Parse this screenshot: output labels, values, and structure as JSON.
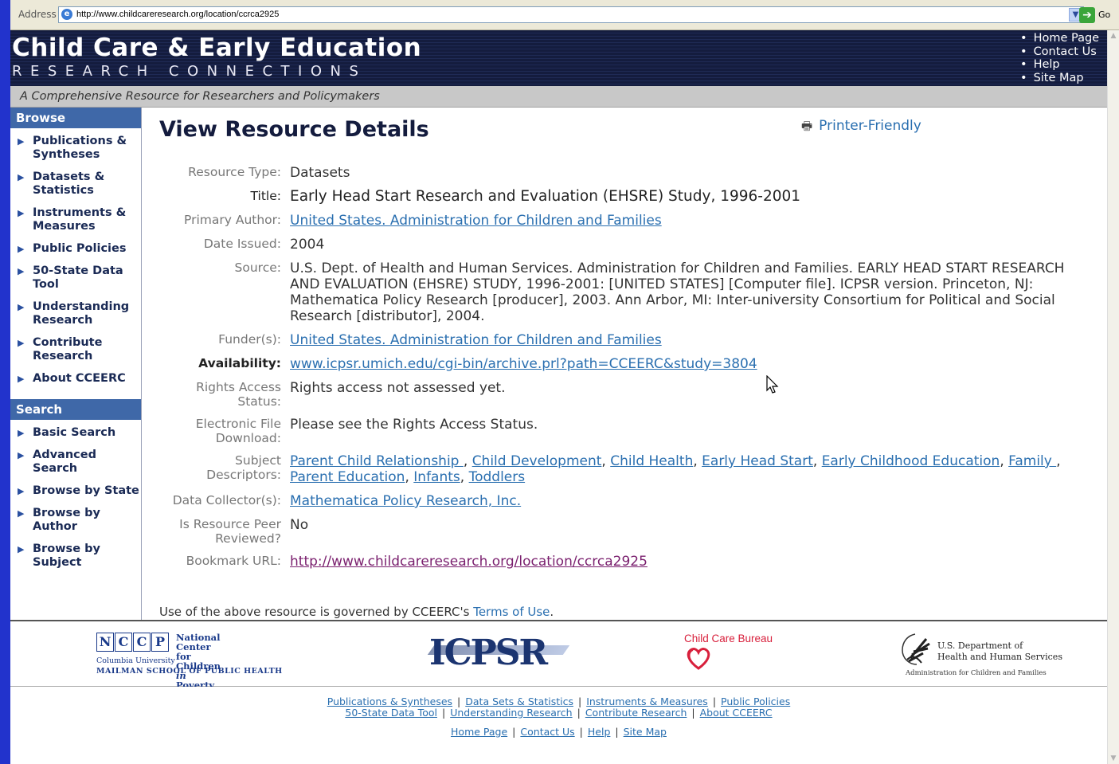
{
  "browser": {
    "address_label": "Address",
    "url": "http://www.childcareresearch.org/location/ccrca2925",
    "go_label": "Go"
  },
  "header": {
    "title": "Child Care & Early Education",
    "subtitle": "RESEARCH CONNECTIONS",
    "top_links": [
      "Home Page",
      "Contact Us",
      "Help",
      "Site Map"
    ],
    "tagline": "A Comprehensive Resource for Researchers and Policymakers"
  },
  "sidebar": {
    "browse_heading": "Browse",
    "browse_items": [
      "Publications & Syntheses",
      "Datasets & Statistics",
      "Instruments & Measures",
      "Public Policies",
      "50-State Data Tool",
      "Understanding Research",
      "Contribute Research",
      "About CCEERC"
    ],
    "search_heading": "Search",
    "search_items": [
      "Basic Search",
      "Advanced Search",
      "Browse by State",
      "Browse by Author",
      "Browse by Subject"
    ]
  },
  "main": {
    "page_title": "View Resource Details",
    "printer_friendly": "Printer-Friendly",
    "fields": {
      "resource_type": {
        "label": "Resource Type:",
        "value": "Datasets"
      },
      "title": {
        "label": "Title:",
        "value": "Early Head Start Research and Evaluation (EHSRE) Study, 1996-2001"
      },
      "primary_author": {
        "label": "Primary Author:",
        "value": "United States. Administration for Children and Families"
      },
      "date_issued": {
        "label": "Date Issued:",
        "value": "2004"
      },
      "source": {
        "label": "Source:",
        "value": "U.S. Dept. of Health and Human Services. Administration for Children and Families. EARLY HEAD START RESEARCH AND EVALUATION (EHSRE) STUDY, 1996-2001: [UNITED STATES] [Computer file]. ICPSR version. Princeton, NJ: Mathematica Policy Research [producer], 2003. Ann Arbor, MI: Inter-university Consortium for Political and Social Research [distributor], 2004."
      },
      "funders": {
        "label": "Funder(s):",
        "value": "United States. Administration for Children and Families"
      },
      "availability": {
        "label": "Availability:",
        "value": "www.icpsr.umich.edu/cgi-bin/archive.prl?path=CCEERC&study=3804"
      },
      "rights_access": {
        "label": "Rights Access Status:",
        "value": "Rights access not assessed yet."
      },
      "electronic_file": {
        "label": "Electronic File Download:",
        "value": "Please see the Rights Access Status."
      },
      "subjects": {
        "label": "Subject Descriptors:",
        "values": [
          "Parent Child Relationship ",
          "Child Development",
          "Child Health",
          "Early Head Start",
          "Early Childhood Education",
          "Family ",
          "Parent Education",
          "Infants",
          "Toddlers"
        ]
      },
      "data_collectors": {
        "label": "Data Collector(s):",
        "value": "Mathematica Policy Research, Inc."
      },
      "peer_reviewed": {
        "label": "Is Resource Peer Reviewed?",
        "value": "No"
      },
      "bookmark_url": {
        "label": "Bookmark URL:",
        "value": "http://www.childcareresearch.org/location/ccrca2925"
      }
    },
    "terms_prefix": "Use of the above resource is governed by CCEERC's ",
    "terms_link": "Terms of Use",
    "terms_suffix": "."
  },
  "logos": {
    "nccp_letters": [
      "N",
      "C",
      "C",
      "P"
    ],
    "nccp_name_line1": "National Center for",
    "nccp_name_line2a": "Children ",
    "nccp_name_line2b": "in",
    "nccp_name_line2c": " Poverty",
    "nccp_sub1": "Columbia University",
    "nccp_sub2": "MAILMAN SCHOOL OF PUBLIC HEALTH",
    "icpsr": "ICPSR",
    "ccb": "Child Care Bureau",
    "hhs_line1": "U.S. Department of",
    "hhs_line2": "Health and Human Services",
    "hhs_sub": "Administration for Children and Families"
  },
  "footer": {
    "line1": [
      "Publications & Syntheses",
      "Data Sets & Statistics",
      "Instruments & Measures",
      "Public Policies"
    ],
    "line2": [
      "50-State Data Tool",
      "Understanding Research",
      "Contribute Research",
      "About CCEERC"
    ],
    "line3": [
      "Home Page",
      "Contact Us",
      "Help",
      "Site Map"
    ]
  },
  "colors": {
    "header_bg": "#141c3e",
    "sidebar_heading": "#3f68a8",
    "link": "#2a6fb0",
    "slide_border": "#2233cc"
  }
}
